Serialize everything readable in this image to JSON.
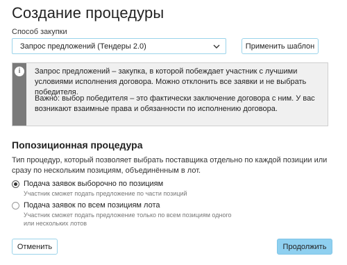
{
  "page": {
    "title": "Создание процедуры"
  },
  "purchase_method": {
    "label": "Способ закупки",
    "selected": "Запрос предложений (Тендеры 2.0)",
    "dropdown_icon": "chevron-down-icon"
  },
  "apply_template_label": "Применить шаблон",
  "info": {
    "icon": "info-icon",
    "paragraph1": "Запрос предложений – закупка, в которой побеждает участник с лучшими условиями исполнения договора. Можно отклонить все заявки и не выбрать победителя.",
    "paragraph2": "Важно: выбор победителя – это фактически заключение договора с ним. У вас возникают взаимные права и обязанности по исполнению договора."
  },
  "positional": {
    "title": "Попозиционная процедура",
    "description": "Тип процедур, который позволяет выбрать поставщика отдельно по каждой позиции или сразу по нескольким позициям, объединённым в лот.",
    "options": [
      {
        "label": "Подача заявок выборочно по позициям",
        "hint": "Участник сможет подать предложение по части позиций",
        "checked": true
      },
      {
        "label": "Подача заявок по всем позициям лота",
        "hint": "Участник сможет подать предложение только по всем позициям одного или нескольких лотов",
        "checked": false
      }
    ]
  },
  "footer": {
    "cancel_label": "Отменить",
    "continue_label": "Продолжить"
  },
  "colors": {
    "accent_border": "#9ad3ea",
    "primary_button": "#8fd0f0",
    "info_bar": "#7a7a7a",
    "info_background": "#f0f0f0"
  }
}
